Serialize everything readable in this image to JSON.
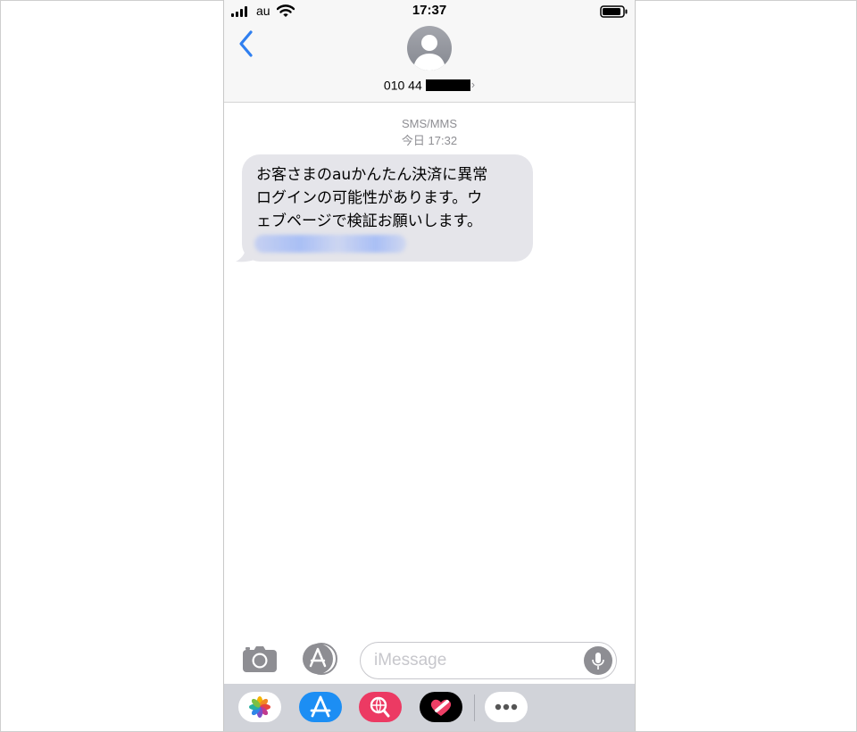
{
  "status_bar": {
    "carrier": "au",
    "time": "17:37"
  },
  "header": {
    "contact_number": "010 44",
    "back_icon": "chevron-left-icon",
    "avatar_icon": "person-silhouette-icon",
    "accent_color": "#2f7ff0"
  },
  "conversation": {
    "service_label": "SMS/MMS",
    "timestamp": "今日 17:32",
    "messages": [
      {
        "direction": "incoming",
        "lines": [
          "お客さまのauかんたん決済に異常",
          "ログインの可能性があります。ウ",
          "ェブページで検証お願いします。"
        ],
        "link_blurred": true
      }
    ]
  },
  "input_bar": {
    "placeholder": "iMessage"
  },
  "app_drawer": {
    "items": [
      "photos-app-icon",
      "app-store-icon",
      "image-search-app-icon",
      "digital-touch-app-icon",
      "more-apps-icon"
    ]
  },
  "colors": {
    "incoming_bubble": "#e5e5ea",
    "header_bg": "#f7f7f7",
    "drawer_bg": "#d1d3d9",
    "app_store_blue": "#1c8ef4",
    "search_app_pink": "#ec3a63"
  }
}
